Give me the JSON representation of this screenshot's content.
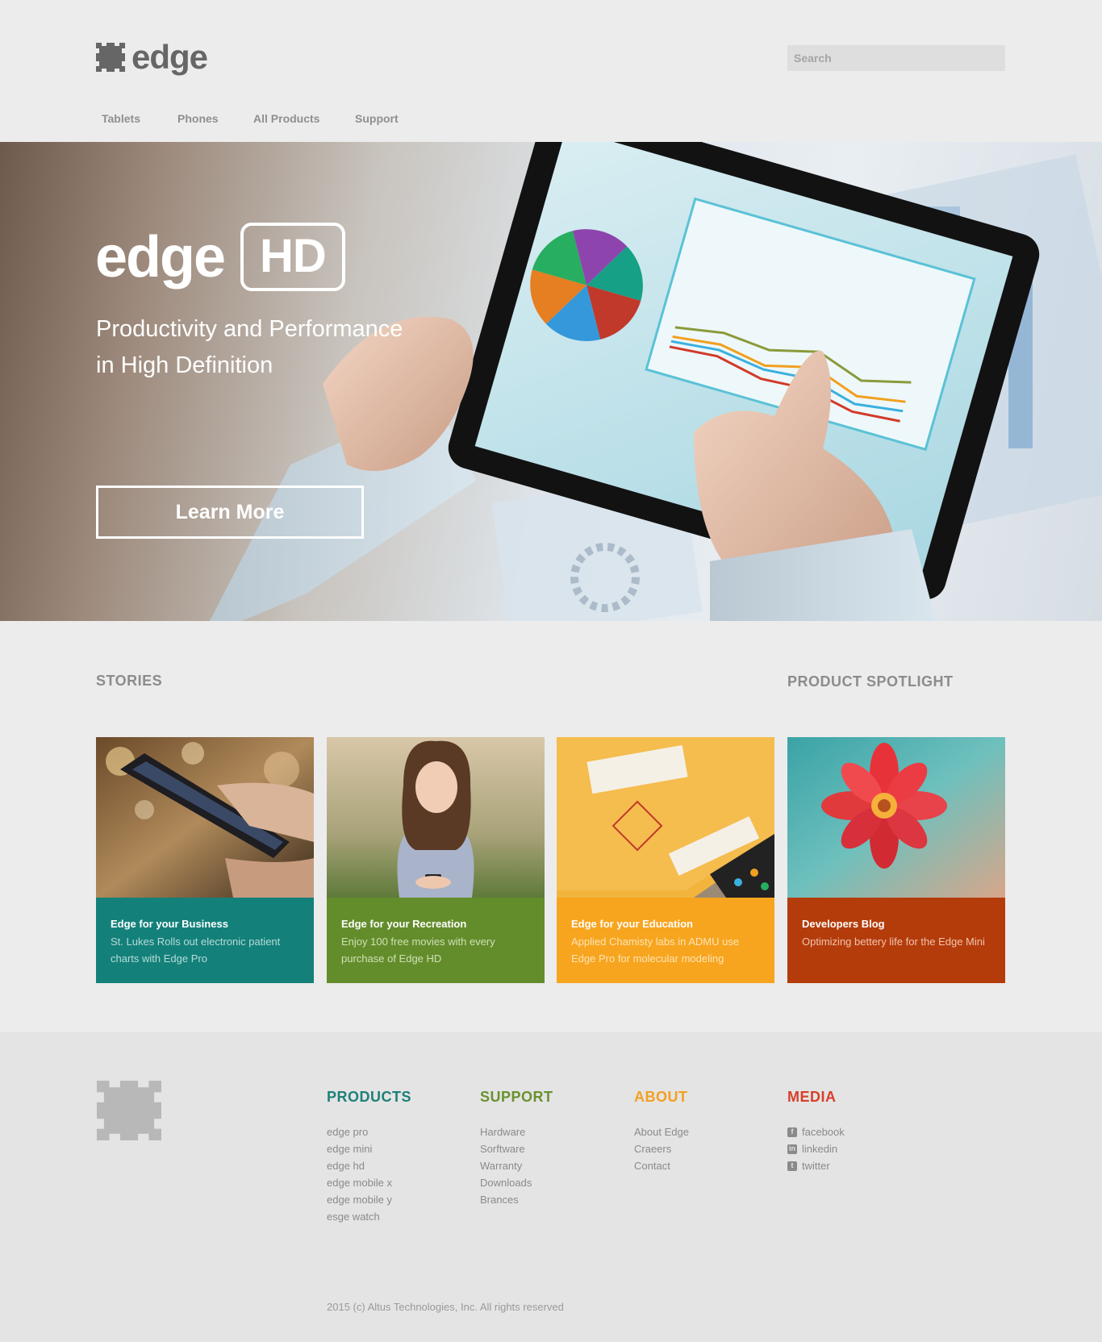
{
  "brand": {
    "name": "edge",
    "logo_icon": "puzzle-block-icon",
    "text_color": "#666666"
  },
  "search": {
    "placeholder": "Search"
  },
  "nav": {
    "items": [
      {
        "label": "Tablets"
      },
      {
        "label": "Phones"
      },
      {
        "label": "All Products"
      },
      {
        "label": "Support"
      }
    ]
  },
  "hero": {
    "title_word": "edge",
    "title_badge": "HD",
    "subtitle_line1": "Productivity and Performance",
    "subtitle_line2": "in High Definition",
    "cta_label": "Learn More"
  },
  "sections": {
    "stories": "STORIES",
    "spotlight": "PRODUCT SPOTLIGHT"
  },
  "cards": [
    {
      "title": "Edge for your Business",
      "description": "St. Lukes Rolls out electronic patient charts with Edge Pro",
      "color": "#14807a"
    },
    {
      "title": "Edge for your Recreation",
      "description": "Enjoy 100 free movies with every purchase of Edge HD",
      "color": "#638d2b"
    },
    {
      "title": "Edge for your Education",
      "description": "Applied Chamisty labs in ADMU use Edge Pro for molecular modeling",
      "color": "#f7a51f"
    },
    {
      "title": "Developers Blog",
      "description": "Optimizing bettery life for the Edge Mini",
      "color": "#b43c0b"
    }
  ],
  "footer": {
    "columns": [
      {
        "heading": "PRODUCTS",
        "color": "#1f8078",
        "items": [
          "edge pro",
          "edge mini",
          "edge hd",
          "edge mobile x",
          "edge mobile y",
          "esge watch"
        ]
      },
      {
        "heading": "SUPPORT",
        "color": "#6a9130",
        "items": [
          "Hardware",
          "Sorftware",
          "Warranty",
          "Downloads",
          "Brances"
        ]
      },
      {
        "heading": "ABOUT",
        "color": "#f3a020",
        "items": [
          "About Edge",
          "Craeers",
          "Contact"
        ]
      },
      {
        "heading": "MEDIA",
        "color": "#d6402a",
        "items": [
          {
            "icon": "facebook-icon",
            "label": "facebook"
          },
          {
            "icon": "linkedin-icon",
            "label": "linkedin"
          },
          {
            "icon": "twitter-icon",
            "label": "twitter"
          }
        ]
      }
    ],
    "copyright": "2015 (c) Altus Technologies, Inc. All rights reserved"
  }
}
